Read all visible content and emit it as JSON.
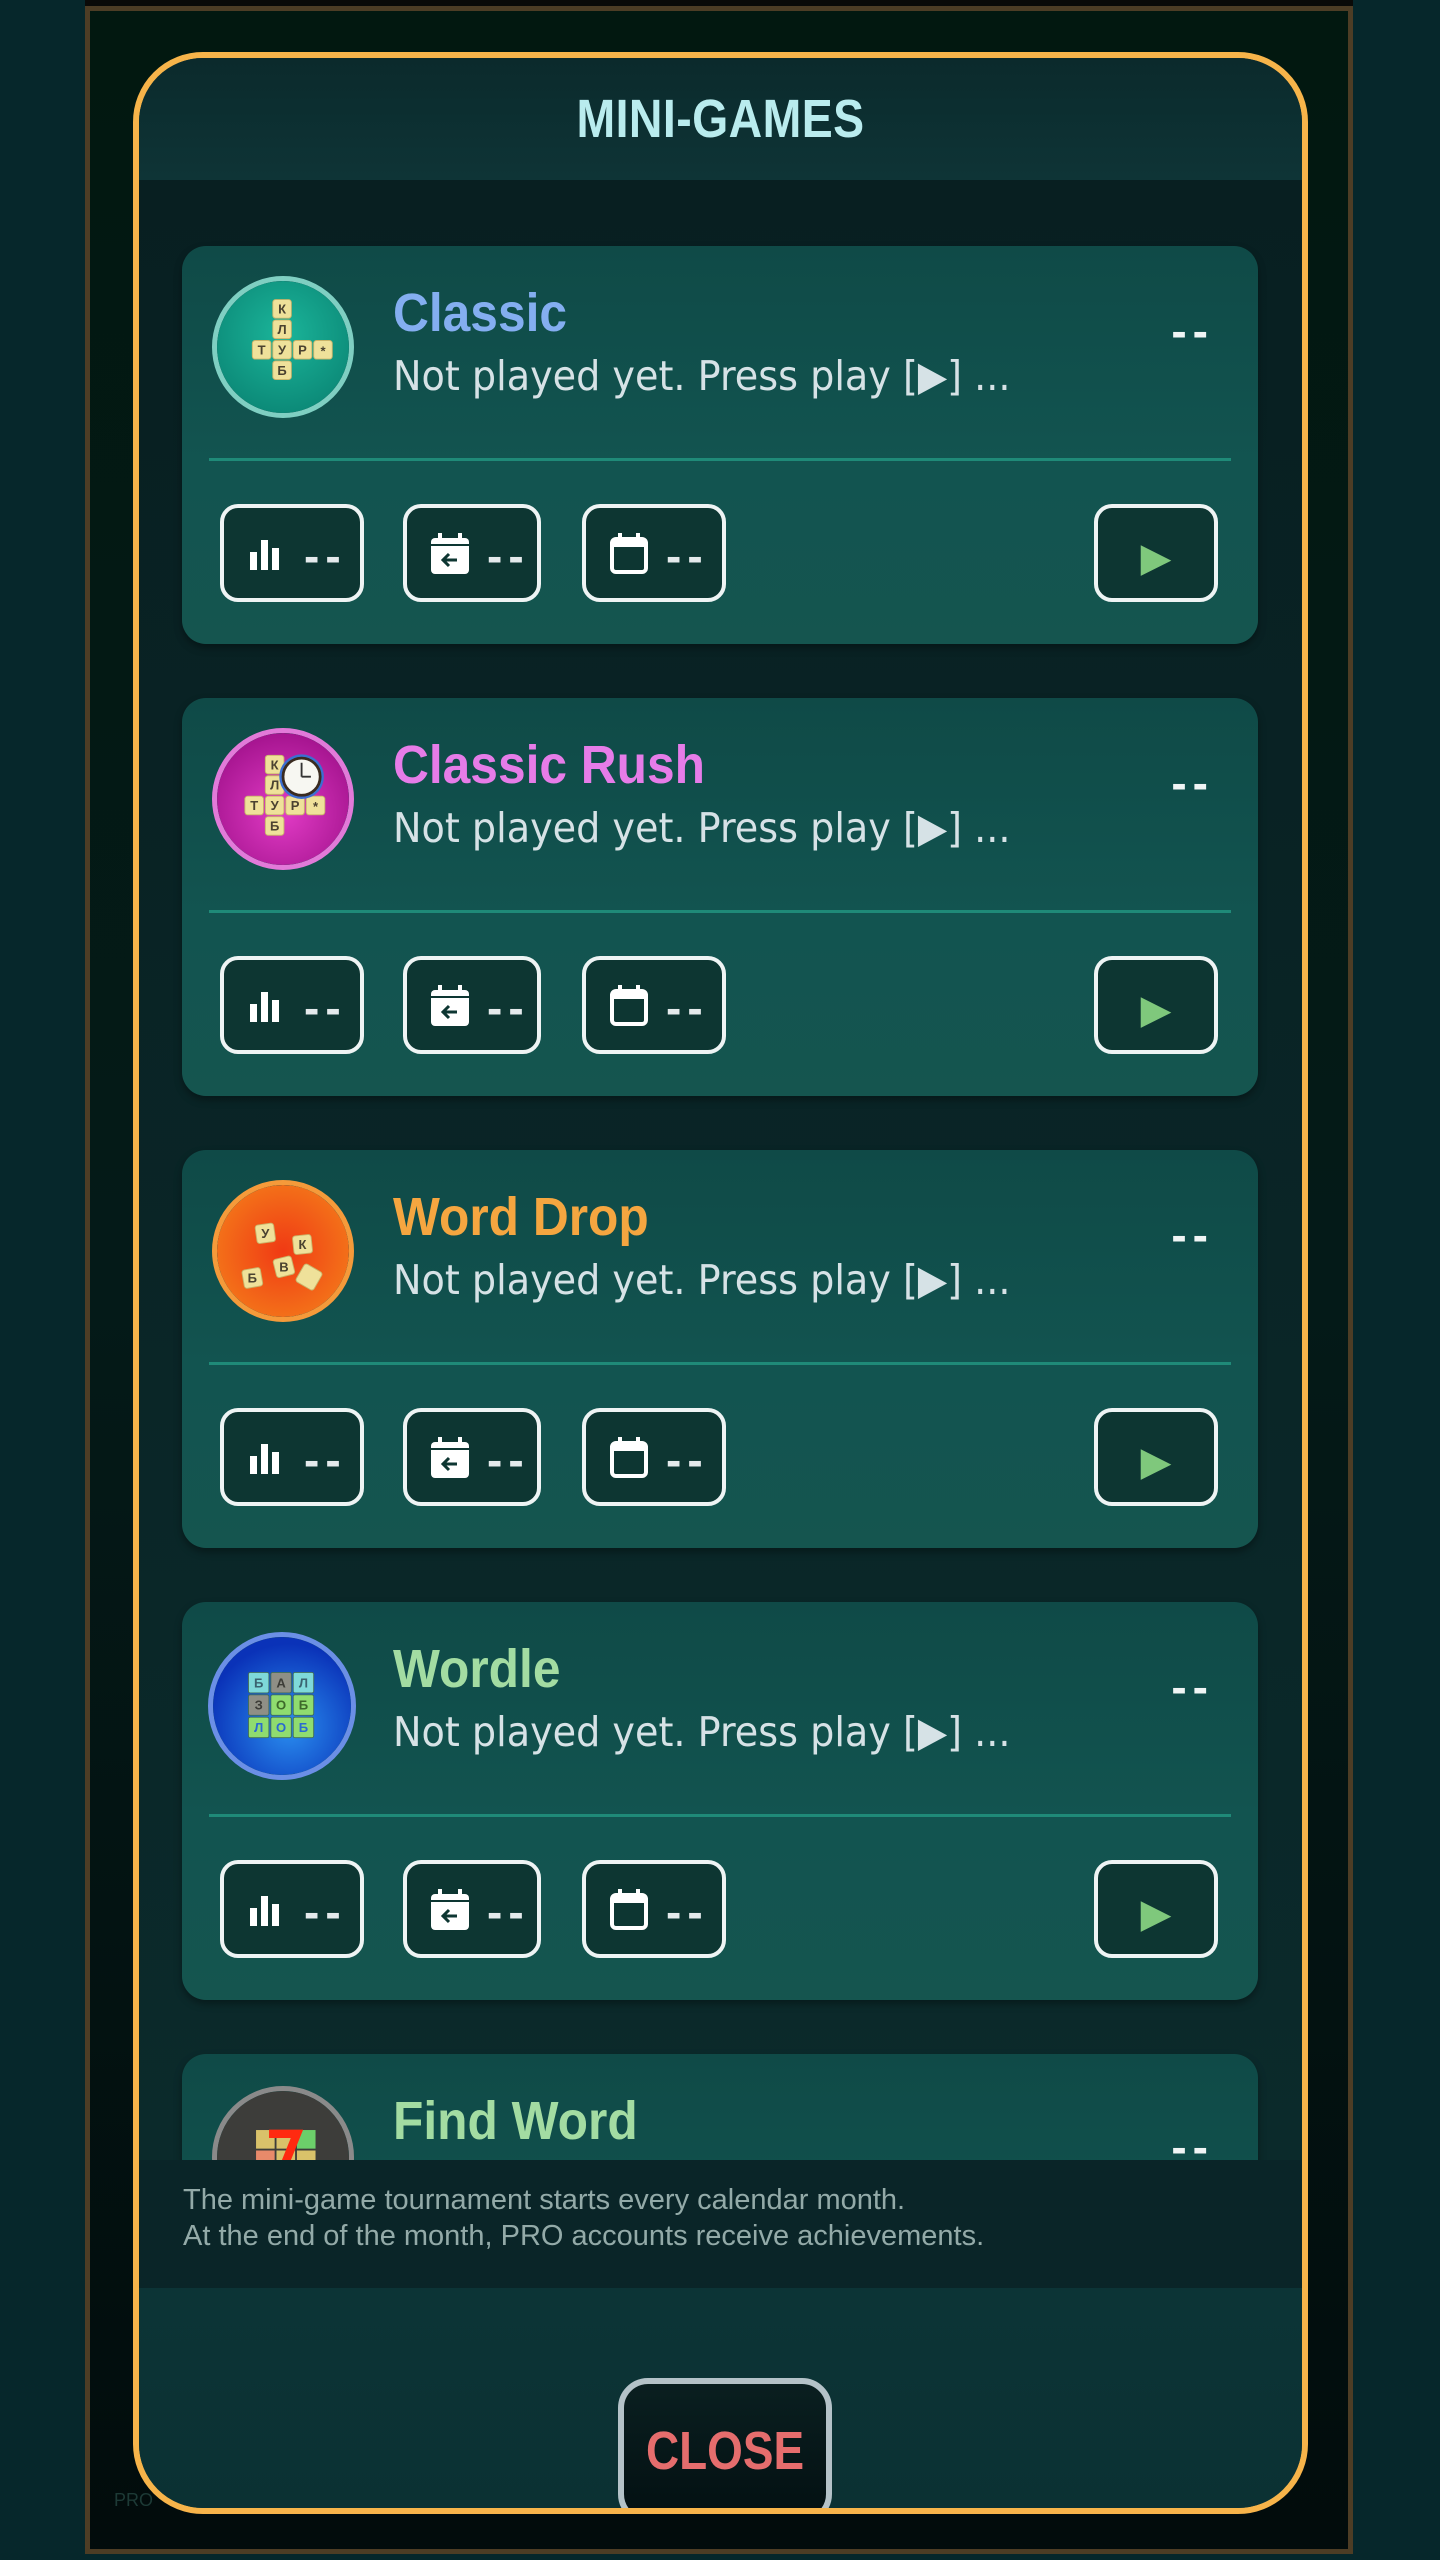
{
  "dialog": {
    "title": "MINI-GAMES",
    "close_label": "CLOSE",
    "footer_lines": [
      "The mini-game tournament starts every calendar month.",
      "At the end of the month, PRO accounts receive achievements."
    ],
    "background_tag": "PRO"
  },
  "colors": {
    "dialog_border": "#f7b44a",
    "title": "#b9ecee",
    "close_text": "#e56d6d",
    "play_icon": "#7fc87c"
  },
  "games": [
    {
      "name": "Classic",
      "name_color": "#84aef0",
      "status": "Not played yet. Press play [▶] ...",
      "score": "--",
      "stats": {
        "rating": "--",
        "last_month": "--",
        "this_month": "--"
      },
      "icon": "crossword-tiles-icon",
      "play_symbol": "▶"
    },
    {
      "name": "Classic Rush",
      "name_color": "#e67ce8",
      "status": "Not played yet. Press play [▶] ...",
      "score": "--",
      "stats": {
        "rating": "--",
        "last_month": "--",
        "this_month": "--"
      },
      "icon": "crossword-timer-icon",
      "play_symbol": "▶"
    },
    {
      "name": "Word Drop",
      "name_color": "#f5a640",
      "status": "Not played yet. Press play [▶] ...",
      "score": "--",
      "stats": {
        "rating": "--",
        "last_month": "--",
        "this_month": "--"
      },
      "icon": "falling-letters-icon",
      "play_symbol": "▶"
    },
    {
      "name": "Wordle",
      "name_color": "#a3dca2",
      "status": "Not played yet. Press play [▶] ...",
      "score": "--",
      "stats": {
        "rating": "--",
        "last_month": "--",
        "this_month": "--"
      },
      "icon": "letter-grid-icon",
      "play_symbol": "▶"
    },
    {
      "name": "Find Word",
      "name_color": "#a3dca2",
      "score": "--",
      "icon": "number-seven-grid-icon"
    }
  ]
}
